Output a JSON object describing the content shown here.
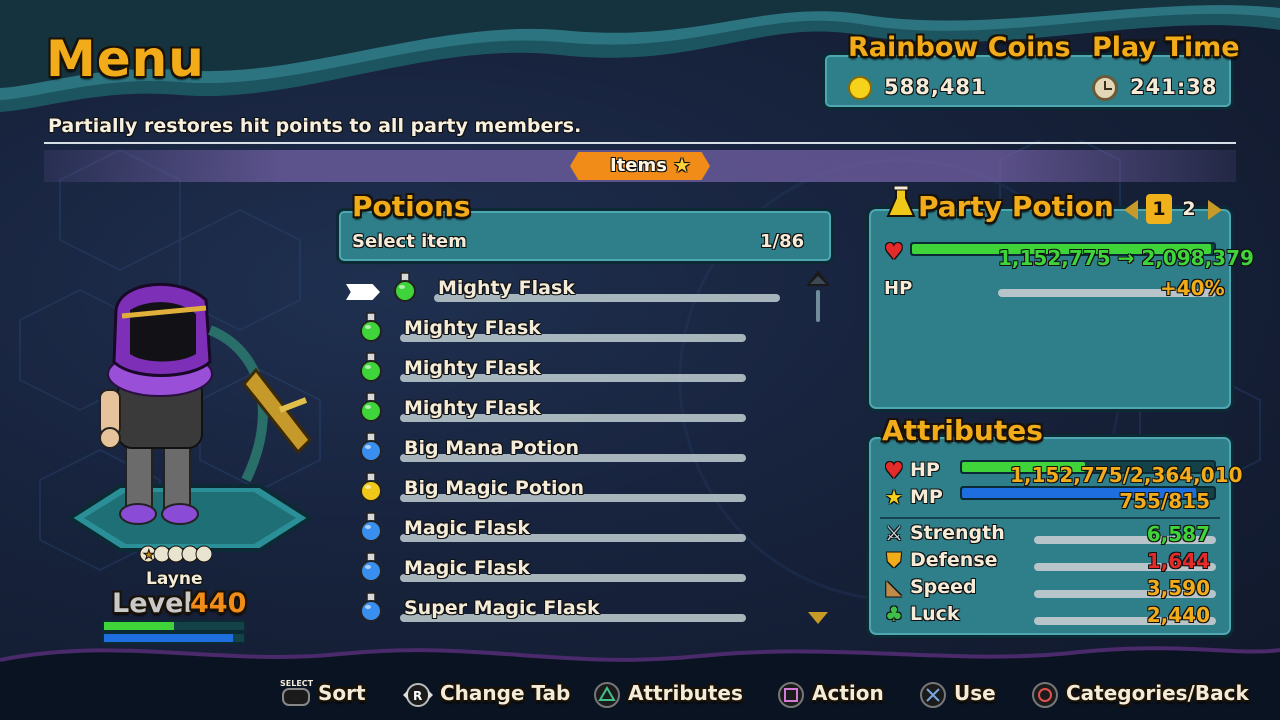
{
  "header": {
    "title": "Menu",
    "description": "Partially restores hit points to all party members."
  },
  "currency": {
    "coins_label": "Rainbow Coins",
    "coins_value": "588,481",
    "playtime_label": "Play Time",
    "playtime_value": "241:38"
  },
  "tab": {
    "label": "Items"
  },
  "potions": {
    "title": "Potions",
    "select_label": "Select item",
    "count": "1/86",
    "items": [
      {
        "name": "Mighty Flask",
        "icon": "green-flask-icon",
        "color": "#3fd43a"
      },
      {
        "name": "Mighty Flask",
        "icon": "green-flask-icon",
        "color": "#3fd43a"
      },
      {
        "name": "Mighty Flask",
        "icon": "green-flask-icon",
        "color": "#3fd43a"
      },
      {
        "name": "Mighty Flask",
        "icon": "green-flask-icon",
        "color": "#3fd43a"
      },
      {
        "name": "Big Mana Potion",
        "icon": "blue-potion-icon",
        "color": "#3a8ef0"
      },
      {
        "name": "Big Magic Potion",
        "icon": "yellow-potion-icon",
        "color": "#f0c81a"
      },
      {
        "name": "Magic Flask",
        "icon": "blue-flask-icon",
        "color": "#3a8ef0"
      },
      {
        "name": "Magic Flask",
        "icon": "blue-flask-icon",
        "color": "#3a8ef0"
      },
      {
        "name": "Super Magic Flask",
        "icon": "blue-super-flask-icon",
        "color": "#3a8ef0"
      }
    ]
  },
  "party_potion": {
    "title": "Party Potion",
    "pages": [
      "1",
      "2"
    ],
    "hp_from": "1,152,775",
    "arrow": "→",
    "hp_to": "2,098,379",
    "hp_label": "HP",
    "hp_percent": "+40%",
    "hp_fill_fraction": 0.5
  },
  "attributes": {
    "title": "Attributes",
    "hp_label": "HP",
    "hp_value": "1,152,775/2,364,010",
    "hp_fraction": 0.49,
    "mp_label": "MP",
    "mp_value": "755/815",
    "mp_fraction": 0.93,
    "stats": [
      {
        "label": "Strength",
        "value": "6,587",
        "color": "#3fd43a",
        "icon": "sword-icon"
      },
      {
        "label": "Defense",
        "value": "1,644",
        "color": "#e52a2a",
        "icon": "shield-icon"
      },
      {
        "label": "Speed",
        "value": "3,590",
        "color": "#f2ac1a",
        "icon": "boot-icon"
      },
      {
        "label": "Luck",
        "value": "2,440",
        "color": "#f2ac1a",
        "icon": "clover-icon"
      }
    ]
  },
  "character": {
    "name": "Layne",
    "level_word": "Level",
    "level": "440",
    "hp_fraction": 0.5,
    "mp_fraction": 0.92
  },
  "controls": [
    {
      "tag": "SELECT",
      "label": "Sort",
      "icon": "select-button-icon"
    },
    {
      "tag": "R",
      "label": "Change Tab",
      "icon": "r-stick-icon"
    },
    {
      "label": "Attributes",
      "icon": "triangle-button-icon"
    },
    {
      "label": "Action",
      "icon": "square-button-icon"
    },
    {
      "label": "Use",
      "icon": "cross-button-icon"
    },
    {
      "label": "Categories/Back",
      "icon": "circle-button-icon"
    }
  ],
  "colors": {
    "accent": "#f2ac1a",
    "panel": "#2f7f8b",
    "hp_green": "#3fd43a",
    "mp_blue": "#1e6ee0",
    "tab_orange": "#f08c17"
  }
}
